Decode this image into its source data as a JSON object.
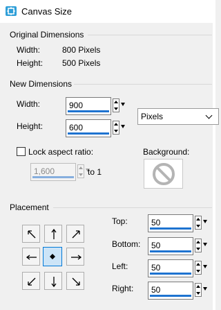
{
  "window": {
    "title": "Canvas Size"
  },
  "original": {
    "section_title": "Original Dimensions",
    "width_label": "Width:",
    "width_value": "800 Pixels",
    "height_label": "Height:",
    "height_value": "500 Pixels"
  },
  "new_dims": {
    "section_title": "New Dimensions",
    "width_label": "Width:",
    "width_value": "900",
    "height_label": "Height:",
    "height_value": "600",
    "units": "Pixels",
    "lock_label": "Lock aspect ratio:",
    "lock_checked": false,
    "ratio_value": "1,600",
    "ratio_suffix": "to 1",
    "background_label": "Background:"
  },
  "placement": {
    "section_title": "Placement",
    "selected_anchor": "center",
    "top_label": "Top:",
    "top_value": "50",
    "bottom_label": "Bottom:",
    "bottom_value": "50",
    "left_label": "Left:",
    "left_value": "50",
    "right_label": "Right:",
    "right_value": "50"
  },
  "colors": {
    "accent": "#1e73d0",
    "title_icon": "#2f9fd8",
    "selection": "#cce4f7"
  },
  "icons": [
    "canvas-size-app-icon",
    "no-symbol-icon",
    "arrow-icons",
    "anchor-dot-icon"
  ]
}
